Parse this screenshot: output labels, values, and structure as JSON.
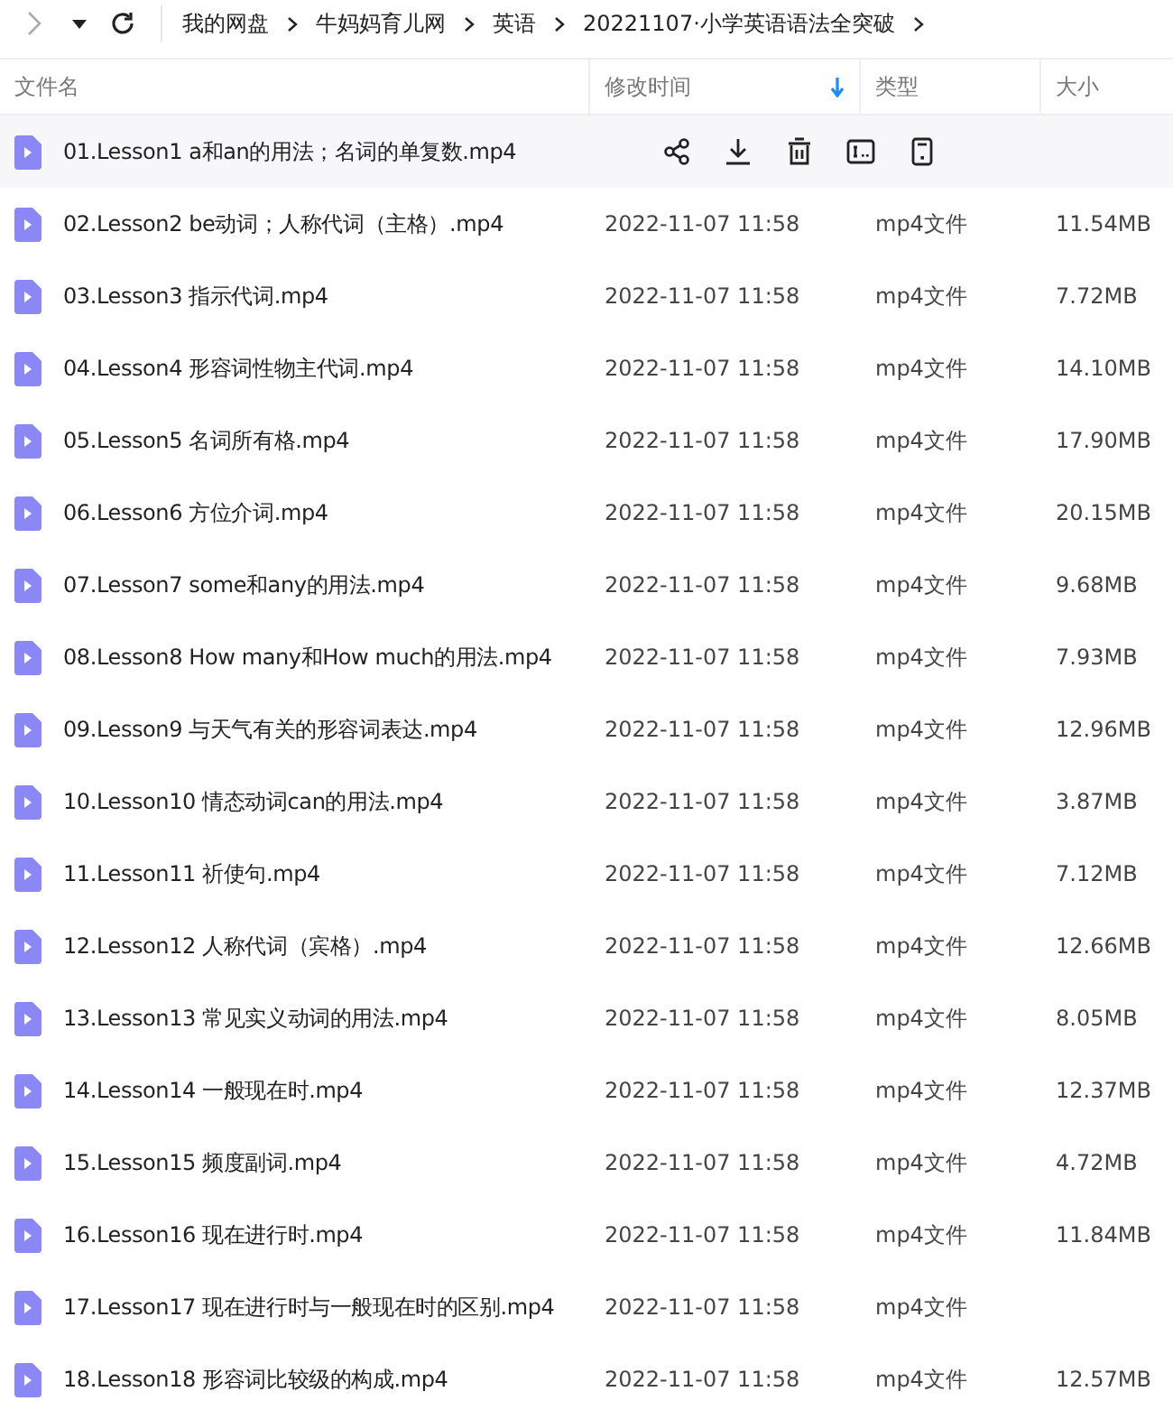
{
  "breadcrumb": [
    "我的网盘",
    "牛妈妈育儿网",
    "英语",
    "20221107·小学英语语法全突破"
  ],
  "columns": [
    {
      "label": "文件名",
      "sorted": false
    },
    {
      "label": "修改时间",
      "sorted": true
    },
    {
      "label": "类型",
      "sorted": false
    },
    {
      "label": "大小",
      "sorted": false
    }
  ],
  "rows": [
    {
      "name": "01.Lesson1 a和an的用法；名词的单复数.mp4",
      "hovered": true
    },
    {
      "name": "02.Lesson2 be动词；人称代词（主格）.mp4",
      "date": "2022-11-07 11:58",
      "type": "mp4文件",
      "size": "11.54MB",
      "hovered": false
    },
    {
      "name": "03.Lesson3 指示代词.mp4",
      "date": "2022-11-07 11:58",
      "type": "mp4文件",
      "size": "7.72MB",
      "hovered": false
    },
    {
      "name": "04.Lesson4 形容词性物主代词.mp4",
      "date": "2022-11-07 11:58",
      "type": "mp4文件",
      "size": "14.10MB",
      "hovered": false
    },
    {
      "name": "05.Lesson5 名词所有格.mp4",
      "date": "2022-11-07 11:58",
      "type": "mp4文件",
      "size": "17.90MB",
      "hovered": false
    },
    {
      "name": "06.Lesson6 方位介词.mp4",
      "date": "2022-11-07 11:58",
      "type": "mp4文件",
      "size": "20.15MB",
      "hovered": false
    },
    {
      "name": "07.Lesson7 some和any的用法.mp4",
      "date": "2022-11-07 11:58",
      "type": "mp4文件",
      "size": "9.68MB",
      "hovered": false
    },
    {
      "name": "08.Lesson8 How many和How much的用法.mp4",
      "date": "2022-11-07 11:58",
      "type": "mp4文件",
      "size": "7.93MB",
      "hovered": false
    },
    {
      "name": "09.Lesson9 与天气有关的形容词表达.mp4",
      "date": "2022-11-07 11:58",
      "type": "mp4文件",
      "size": "12.96MB",
      "hovered": false
    },
    {
      "name": "10.Lesson10 情态动词can的用法.mp4",
      "date": "2022-11-07 11:58",
      "type": "mp4文件",
      "size": "3.87MB",
      "hovered": false
    },
    {
      "name": "11.Lesson11 祈使句.mp4",
      "date": "2022-11-07 11:58",
      "type": "mp4文件",
      "size": "7.12MB",
      "hovered": false
    },
    {
      "name": "12.Lesson12 人称代词（宾格）.mp4",
      "date": "2022-11-07 11:58",
      "type": "mp4文件",
      "size": "12.66MB",
      "hovered": false
    },
    {
      "name": "13.Lesson13 常见实义动词的用法.mp4",
      "date": "2022-11-07 11:58",
      "type": "mp4文件",
      "size": "8.05MB",
      "hovered": false
    },
    {
      "name": "14.Lesson14 一般现在时.mp4",
      "date": "2022-11-07 11:58",
      "type": "mp4文件",
      "size": "12.37MB",
      "hovered": false
    },
    {
      "name": "15.Lesson15 频度副词.mp4",
      "date": "2022-11-07 11:58",
      "type": "mp4文件",
      "size": "4.72MB",
      "hovered": false
    },
    {
      "name": "16.Lesson16 现在进行时.mp4",
      "date": "2022-11-07 11:58",
      "type": "mp4文件",
      "size": "11.84MB",
      "hovered": false
    },
    {
      "name": "17.Lesson17 现在进行时与一般现在时的区别.mp4",
      "date": "2022-11-07 11:58",
      "type": "mp4文件",
      "hovered": false
    },
    {
      "name": "18.Lesson18 形容词比较级的构成.mp4",
      "date": "2022-11-07 11:58",
      "type": "mp4文件",
      "size": "12.57MB",
      "hovered": false
    }
  ]
}
